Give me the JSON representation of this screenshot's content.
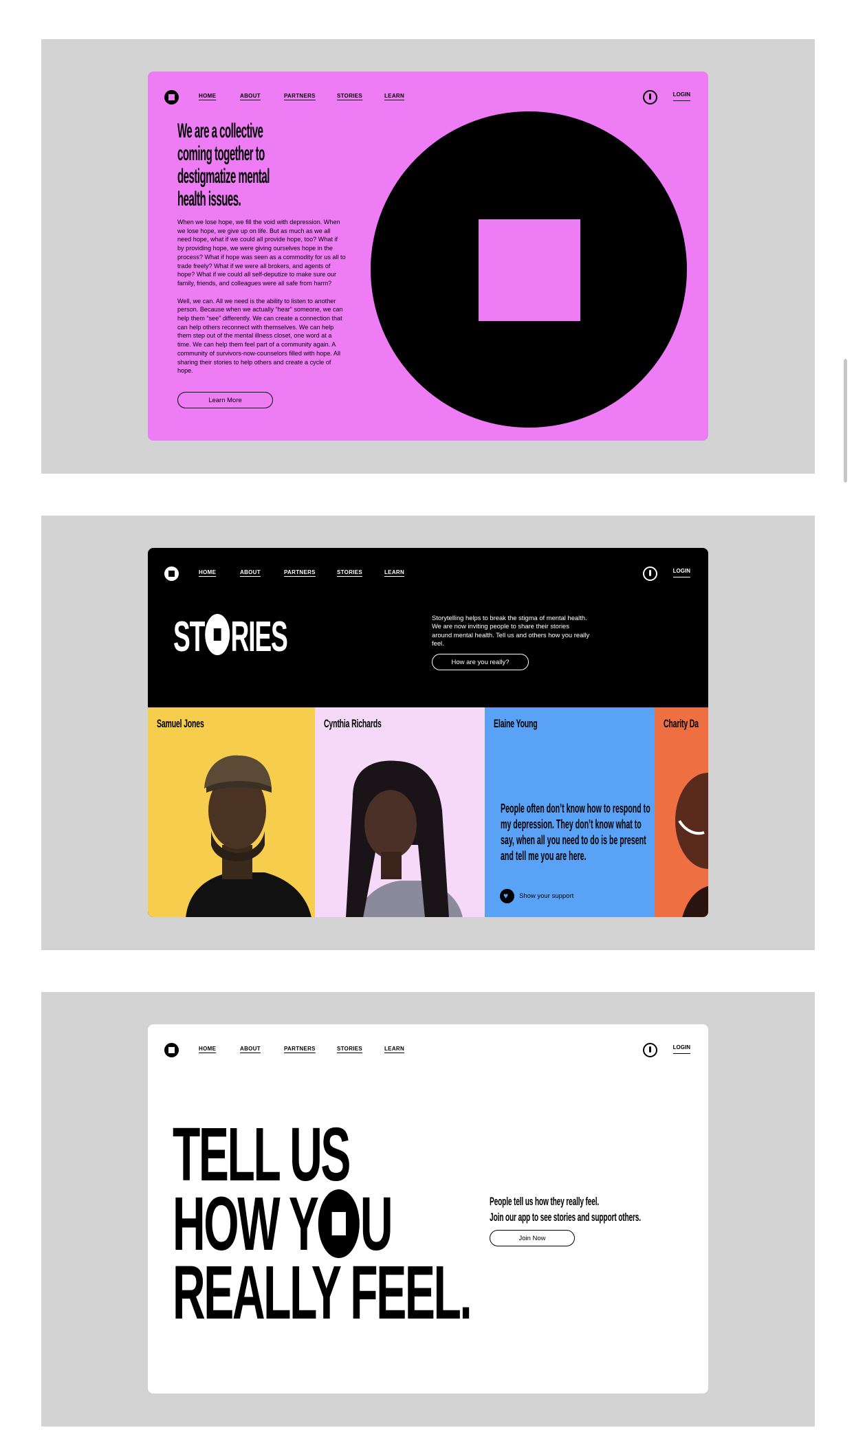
{
  "nav": {
    "links": [
      "HOME",
      "ABOUT",
      "PARTNERS",
      "STORIES",
      "LEARN"
    ],
    "login": "LOGIN"
  },
  "hero": {
    "headline_lines": [
      "We are a collective",
      "coming together to",
      "destigmatize mental",
      "health issues."
    ],
    "paragraph1": "When we lose hope, we fill the void with depression. When we lose hope, we give up on life. But as much as we all need hope, what if we could all provide hope, too? What if by providing hope, we were giving ourselves hope in the process? What if hope was seen as a commodity for us all to trade freely? What if we were all brokers, and agents of hope? What if we could all self-deputize to make sure our family, friends, and colleagues were all safe from harm?",
    "paragraph2": "Well, we can. All we need is the ability to listen to another person. Because when we actually “hear” someone, we can help them “see” differently. We can create a connection that can help others reconnect with themselves. We can help them step out of the mental illness closet, one word at a time. We can help them feel part of a community again. A community of survivors-now-counselors filled with hope. All sharing their stories to help others and create a cycle of hope.",
    "button": "Learn More"
  },
  "stories": {
    "title_part1": "ST",
    "title_part2": "RIES",
    "description": "Storytelling helps to break the stigma of mental health. We are now inviting people to share their stories around mental health. Tell us and others how you really feel.",
    "button": "How are you really?",
    "people": [
      {
        "name": "Samuel Jones",
        "color": "#f6cd4c"
      },
      {
        "name": "Cynthia Richards",
        "color": "#f6d9f8"
      },
      {
        "name": "Elaine Young",
        "color": "#5aa2f6"
      },
      {
        "name": "Charity Da",
        "color": "#ee6f42"
      }
    ],
    "quote": "People often don’t know how to respond to my depression. They don’t know what to say, when all you need to do is be present and tell me you are here.",
    "support": "Show your support"
  },
  "join": {
    "line1": "TELL US",
    "line2a": "HOW Y",
    "line2b": "U",
    "line3": "REALLY FEEL.",
    "text_line1": "People tell us how they really feel.",
    "text_line2": "Join our app to see stories and support others.",
    "button": "Join Now"
  },
  "colors": {
    "pink": "#ed7cf5",
    "yellow": "#f6cd4c",
    "lilac": "#f6d9f8",
    "blue": "#5aa2f6",
    "orange": "#ee6f42",
    "panel_gray": "#d3d3d3"
  },
  "icons": [
    "logo-circle-square-icon",
    "alert-circle-icon",
    "heart-icon"
  ]
}
